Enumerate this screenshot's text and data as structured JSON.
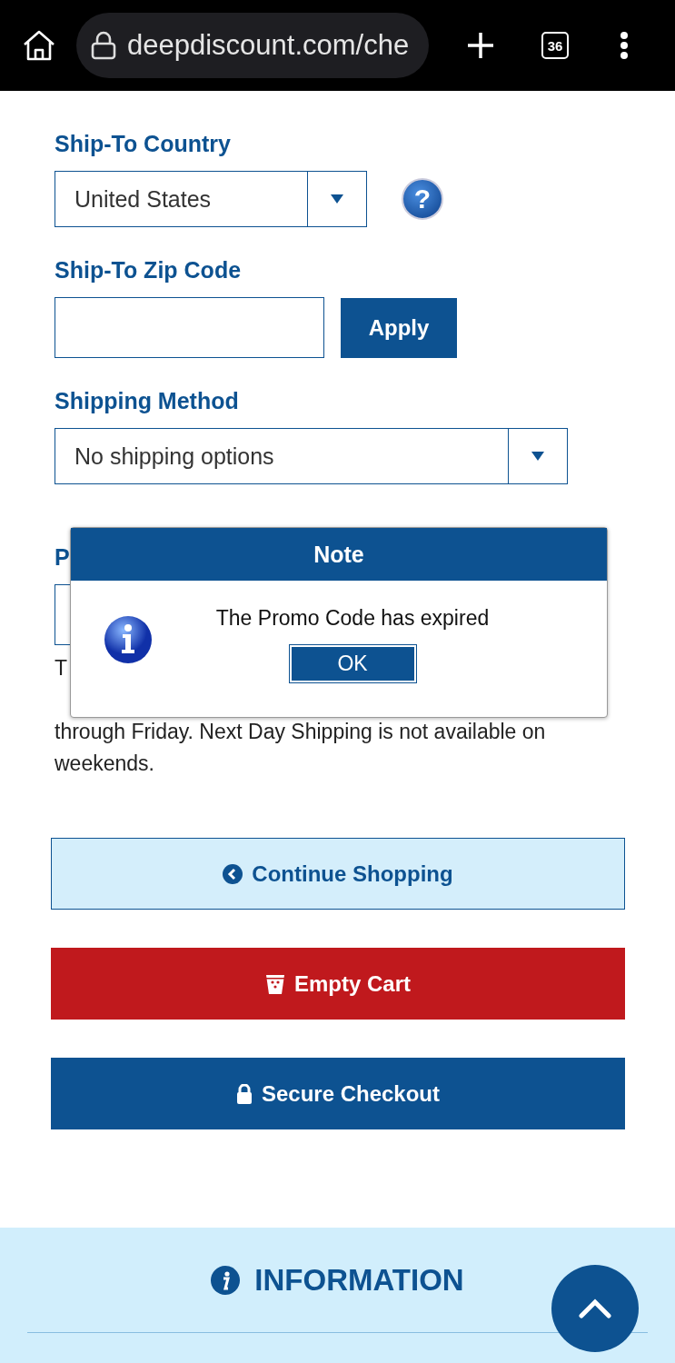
{
  "browser": {
    "url": "deepdiscount.com/che",
    "tab_count": "36"
  },
  "form": {
    "country": {
      "label": "Ship-To Country",
      "value": "United States",
      "help": "?"
    },
    "zip": {
      "label": "Ship-To Zip Code",
      "button": "Apply"
    },
    "shipping": {
      "label": "Shipping Method",
      "value": "No shipping options"
    },
    "promo": {
      "label": "P"
    },
    "notice_lines": [
      "T",
      "through Friday. Next Day Shipping is not available on weekends."
    ]
  },
  "buttons": [
    {
      "kind": "continue",
      "label": "Continue Shopping"
    },
    {
      "kind": "empty",
      "label": "Empty Cart"
    },
    {
      "kind": "checkout",
      "label": "Secure Checkout"
    }
  ],
  "dialog": {
    "title": "Note",
    "message": "The Promo Code has expired",
    "button": "OK"
  },
  "footer": {
    "sections": [
      "INFORMATION"
    ]
  }
}
